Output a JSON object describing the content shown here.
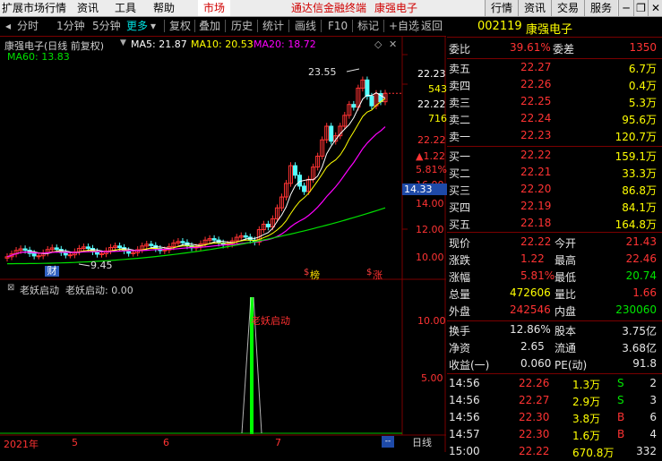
{
  "menubar": {
    "items": [
      "扩展市场行情",
      "资讯",
      "工具",
      "帮助"
    ],
    "market": "市场",
    "promo": "通达信金融终端",
    "stock": "康强电子",
    "right_buttons": [
      "行情",
      "资讯",
      "交易",
      "服务"
    ]
  },
  "toolbar": {
    "items": [
      "分时",
      "1分钟",
      "5分钟",
      "更多",
      "复权",
      "叠加",
      "历史",
      "统计",
      "画线",
      "F10",
      "标记",
      "+自选",
      "返回"
    ]
  },
  "chart_header": {
    "title": "康强电子(日线 前复权)",
    "ma5": "MA5: 21.87",
    "ma10": "MA10: 20.53",
    "ma20": "MA20: 18.72",
    "ma60": "MA60: 13.83",
    "colors": {
      "ma5": "#ffffff",
      "ma10": "#ffff00",
      "ma20": "#ff00ff",
      "ma60": "#00e000"
    }
  },
  "price_axis": {
    "ticks": [
      "22.23",
      "543",
      "22.22",
      "716",
      "22.22",
      "1.22",
      "5.81%",
      "16.00",
      "14.00",
      "12.00",
      "10.00"
    ],
    "current": "14.33"
  },
  "chart_annotations": {
    "high": "23.55",
    "low": "9.45",
    "event_labels": [
      "财",
      "$",
      "榜",
      "$",
      "涨"
    ]
  },
  "indicator": {
    "name": "老妖启动",
    "value_label": "老妖启动: 0.00",
    "signal_label": "老妖启动",
    "axis": [
      "10.00",
      "5.00"
    ]
  },
  "time_axis": {
    "labels": [
      "2021年",
      "5",
      "6",
      "7"
    ],
    "period": "日线"
  },
  "quote": {
    "code": "002119",
    "name": "康强电子",
    "weibi": {
      "label": "委比",
      "pct": "39.61%",
      "label2": "委差",
      "value": "1350"
    },
    "asks": [
      {
        "label": "卖五",
        "price": "22.27",
        "vol": "6.7万"
      },
      {
        "label": "卖四",
        "price": "22.26",
        "vol": "0.4万"
      },
      {
        "label": "卖三",
        "price": "22.25",
        "vol": "5.3万"
      },
      {
        "label": "卖二",
        "price": "22.24",
        "vol": "95.6万"
      },
      {
        "label": "卖一",
        "price": "22.23",
        "vol": "120.7万"
      }
    ],
    "bids": [
      {
        "label": "买一",
        "price": "22.22",
        "vol": "159.1万"
      },
      {
        "label": "买二",
        "price": "22.21",
        "vol": "33.3万"
      },
      {
        "label": "买三",
        "price": "22.20",
        "vol": "86.8万"
      },
      {
        "label": "买四",
        "price": "22.19",
        "vol": "84.1万"
      },
      {
        "label": "买五",
        "price": "22.18",
        "vol": "164.8万"
      }
    ],
    "stats": [
      {
        "l1": "现价",
        "v1": "22.22",
        "l2": "今开",
        "v2": "21.43"
      },
      {
        "l1": "涨跌",
        "v1": "1.22",
        "l2": "最高",
        "v2": "22.46"
      },
      {
        "l1": "涨幅",
        "v1": "5.81%",
        "l2": "最低",
        "v2": "20.74"
      },
      {
        "l1": "总量",
        "v1": "472606",
        "l2": "量比",
        "v2": "1.66"
      },
      {
        "l1": "外盘",
        "v1": "242546",
        "l2": "内盘",
        "v2": "230060"
      }
    ],
    "stats2": [
      {
        "l1": "换手",
        "v1": "12.86%",
        "l2": "股本",
        "v2": "3.75亿"
      },
      {
        "l1": "净资",
        "v1": "2.65",
        "l2": "流通",
        "v2": "3.68亿"
      },
      {
        "l1": "收益(一)",
        "v1": "0.060",
        "l2": "PE(动)",
        "v2": "91.8"
      }
    ],
    "ticks": [
      {
        "time": "14:56",
        "price": "22.26",
        "vol": "1.3万",
        "side": "S",
        "n": "2"
      },
      {
        "time": "14:56",
        "price": "22.27",
        "vol": "2.9万",
        "side": "S",
        "n": "3"
      },
      {
        "time": "14:56",
        "price": "22.30",
        "vol": "3.8万",
        "side": "B",
        "n": "6"
      },
      {
        "time": "14:57",
        "price": "22.30",
        "vol": "1.6万",
        "side": "B",
        "n": "4"
      },
      {
        "time": "15:00",
        "price": "22.22",
        "vol": "670.8万",
        "side": "",
        "n": "332"
      }
    ]
  }
}
